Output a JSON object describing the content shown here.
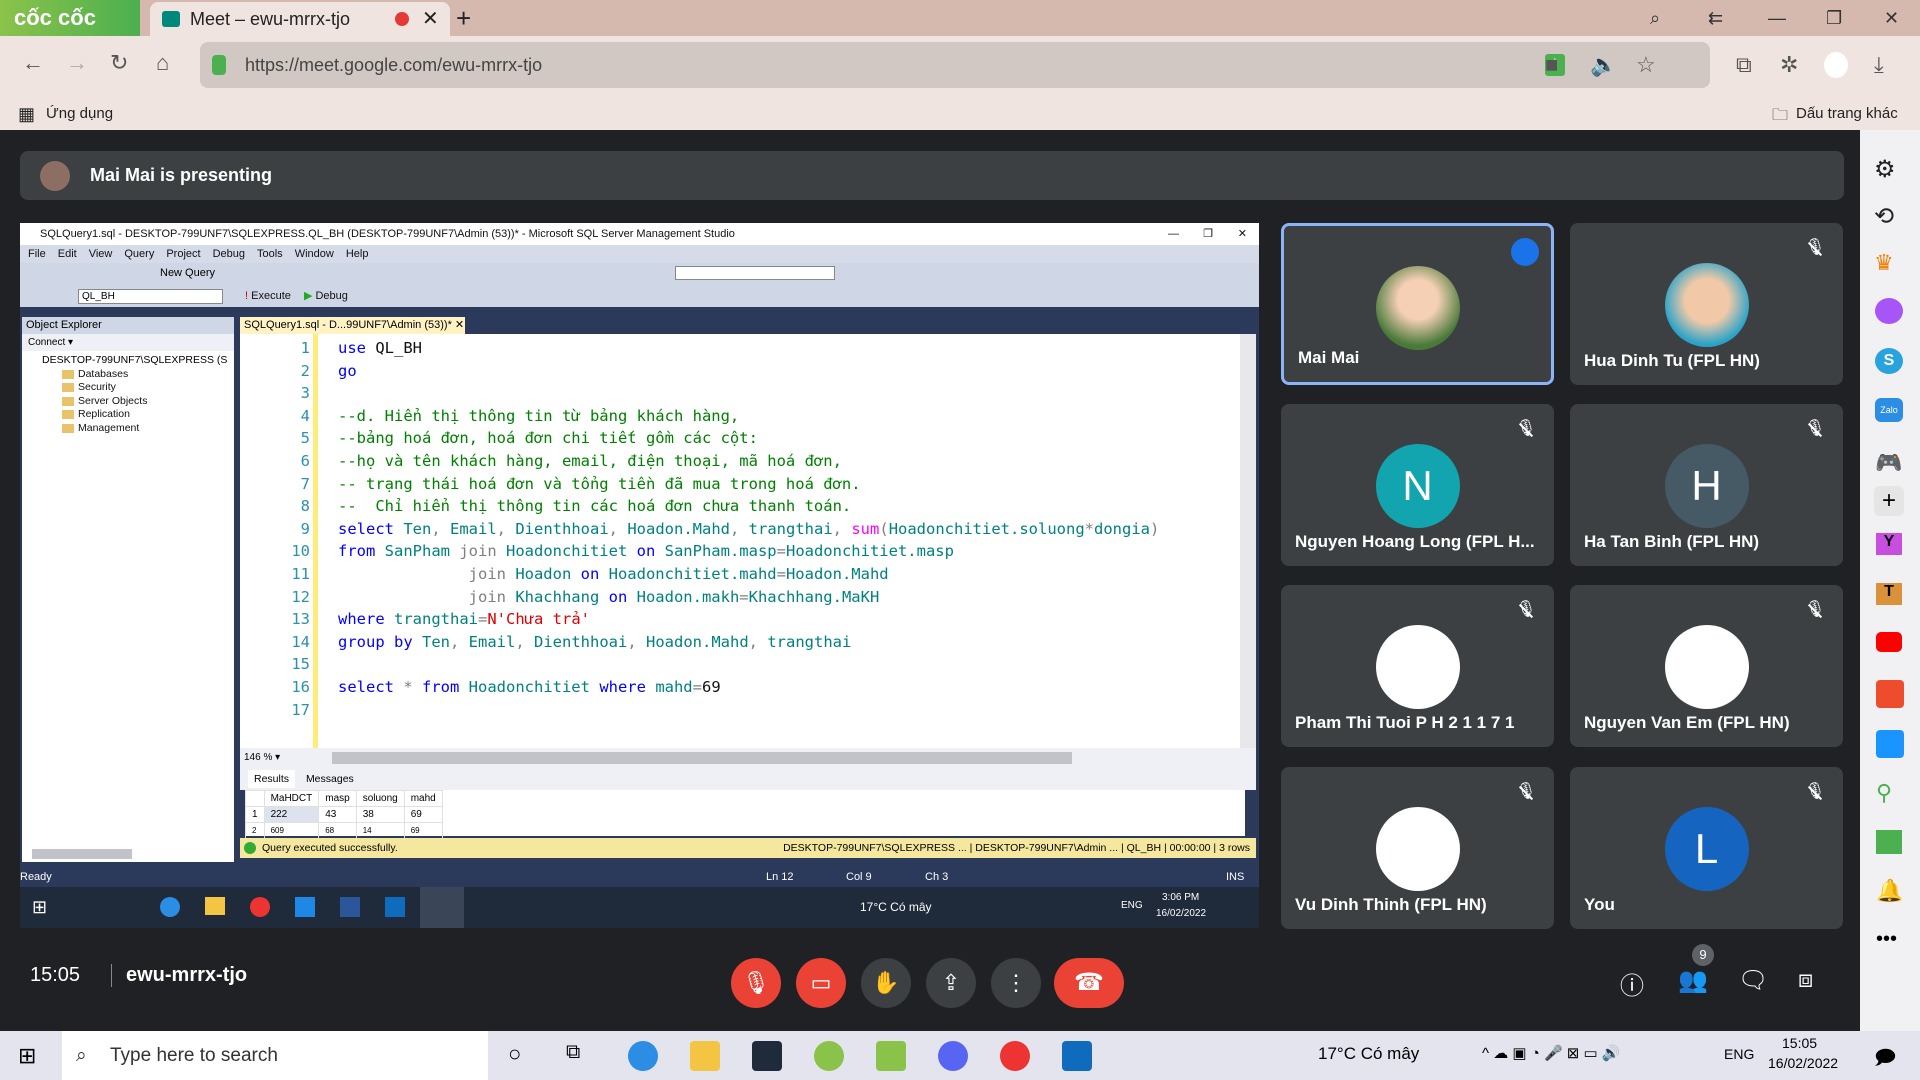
{
  "browser": {
    "brand": "cốc cốc",
    "tab_title": "Meet – ewu-mrrx-tjo",
    "url": "https://meet.google.com/ewu-mrrx-tjo",
    "bookmarks_apps": "Ứng dụng",
    "bookmarks_other": "Dấu trang khác"
  },
  "meet": {
    "presenting": "Mai Mai is presenting",
    "time": "15:05",
    "meeting_code": "ewu-mrrx-tjo",
    "participants_count": "9",
    "tiles": [
      {
        "name": "Mai Mai",
        "type": "photo",
        "speaking": true
      },
      {
        "name": "Hua Dinh Tu (FPL HN)",
        "type": "photo",
        "muted": true
      },
      {
        "name": "Nguyen Hoang Long (FPL H...",
        "initial": "N",
        "color": "#12a4af",
        "muted": true
      },
      {
        "name": "Ha Tan Binh (FPL HN)",
        "initial": "H",
        "color": "#455a64",
        "muted": true
      },
      {
        "name": "Pham Thi Tuoi P H 2 1 1 7 1",
        "type": "sticker",
        "muted": true
      },
      {
        "name": "Nguyen Van Em (FPL HN)",
        "type": "sticker",
        "muted": true
      },
      {
        "name": "Vu Dinh Thinh (FPL HN)",
        "type": "sticker",
        "muted": true
      },
      {
        "name": "You",
        "initial": "L",
        "color": "#1565c0",
        "muted": true
      }
    ]
  },
  "ssms": {
    "title": "SQLQuery1.sql - DESKTOP-799UNF7\\SQLEXPRESS.QL_BH (DESKTOP-799UNF7\\Admin (53))* - Microsoft SQL Server Management Studio",
    "menu": [
      "File",
      "Edit",
      "View",
      "Query",
      "Project",
      "Debug",
      "Tools",
      "Window",
      "Help"
    ],
    "new_query": "New Query",
    "database": "QL_BH",
    "execute": "Execute",
    "debug": "Debug",
    "object_explorer": "Object Explorer",
    "connect": "Connect ▾",
    "server": "DESKTOP-799UNF7\\SQLEXPRESS (S",
    "tree": [
      "Databases",
      "Security",
      "Server Objects",
      "Replication",
      "Management"
    ],
    "editor_tab": "SQLQuery1.sql - D...99UNF7\\Admin (53))*",
    "zoom": "146 %",
    "results_tab": "Results",
    "messages_tab": "Messages",
    "grid_headers": [
      "",
      "MaHDCT",
      "masp",
      "soluong",
      "mahd"
    ],
    "grid_rows": [
      [
        "1",
        "222",
        "43",
        "38",
        "69"
      ],
      [
        "2",
        "609",
        "68",
        "14",
        "69"
      ]
    ],
    "status_msg": "Query executed successfully.",
    "status_server": "DESKTOP-799UNF7\\SQLEXPRESS ...",
    "status_user": "DESKTOP-799UNF7\\Admin ...",
    "status_db": "QL_BH",
    "status_time": "00:00:00",
    "status_rows": "3 rows",
    "ready": "Ready",
    "ln": "Ln 12",
    "col": "Col 9",
    "ch": "Ch 3",
    "ins": "INS",
    "remote_weather": "17°C  Có mây",
    "remote_lang": "ENG",
    "remote_time": "3:06 PM",
    "remote_date": "16/02/2022"
  },
  "code": [
    [
      [
        "kw",
        "use"
      ],
      [
        "",
        " QL_BH"
      ]
    ],
    [
      [
        "kw",
        "go"
      ]
    ],
    [],
    [
      [
        "cm",
        "--d. Hiển thị thông tin từ bảng khách hàng,"
      ]
    ],
    [
      [
        "cm",
        "--bảng hoá đơn, hoá đơn chi tiết gồm các cột:"
      ]
    ],
    [
      [
        "cm",
        "--họ và tên khách hàng, email, điện thoại, mã hoá đơn,"
      ]
    ],
    [
      [
        "cm",
        "-- trạng thái hoá đơn và tổng tiền đã mua trong hoá đơn."
      ]
    ],
    [
      [
        "cm",
        "--  Chỉ hiển thị thông tin các hoá đơn chưa thanh toán."
      ]
    ],
    [
      [
        "kw",
        "select"
      ],
      [
        "id",
        " Ten"
      ],
      [
        "gr",
        ","
      ],
      [
        "id",
        " Email"
      ],
      [
        "gr",
        ","
      ],
      [
        "id",
        " Dienthhoai"
      ],
      [
        "gr",
        ","
      ],
      [
        "id",
        " Hoadon.Mahd"
      ],
      [
        "gr",
        ","
      ],
      [
        "id",
        " trangthai"
      ],
      [
        "gr",
        ", "
      ],
      [
        "fn",
        "sum"
      ],
      [
        "gr",
        "("
      ],
      [
        "id",
        "Hoadonchitiet.soluong"
      ],
      [
        "gr",
        "*"
      ],
      [
        "id",
        "dongia"
      ],
      [
        "gr",
        ")"
      ]
    ],
    [
      [
        "kw",
        "from"
      ],
      [
        "id",
        " SanPham "
      ],
      [
        "gr",
        "join"
      ],
      [
        "id",
        " Hoadonchitiet "
      ],
      [
        "kw",
        "on"
      ],
      [
        "id",
        " SanPham.masp"
      ],
      [
        "gr",
        "="
      ],
      [
        "id",
        "Hoadonchitiet.masp"
      ]
    ],
    [
      [
        "",
        "              "
      ],
      [
        "gr",
        "join"
      ],
      [
        "id",
        " Hoadon "
      ],
      [
        "kw",
        "on"
      ],
      [
        "id",
        " Hoadonchitiet.mahd"
      ],
      [
        "gr",
        "="
      ],
      [
        "id",
        "Hoadon.Mahd"
      ]
    ],
    [
      [
        "",
        "              "
      ],
      [
        "gr",
        "join"
      ],
      [
        "id",
        " Khachhang "
      ],
      [
        "kw",
        "on"
      ],
      [
        "id",
        " Hoadon.makh"
      ],
      [
        "gr",
        "="
      ],
      [
        "id",
        "Khachhang.MaKH"
      ]
    ],
    [
      [
        "kw",
        "where"
      ],
      [
        "id",
        " trangthai"
      ],
      [
        "gr",
        "="
      ],
      [
        "st",
        "N'Chưa trả'"
      ]
    ],
    [
      [
        "kw",
        "group by"
      ],
      [
        "id",
        " Ten"
      ],
      [
        "gr",
        ","
      ],
      [
        "id",
        " Email"
      ],
      [
        "gr",
        ","
      ],
      [
        "id",
        " Dienthhoai"
      ],
      [
        "gr",
        ","
      ],
      [
        "id",
        " Hoadon.Mahd"
      ],
      [
        "gr",
        ","
      ],
      [
        "id",
        " trangthai"
      ]
    ],
    [],
    [
      [
        "kw",
        "select"
      ],
      [
        "gr",
        " * "
      ],
      [
        "kw",
        "from"
      ],
      [
        "id",
        " Hoadonchitiet "
      ],
      [
        "kw",
        "where"
      ],
      [
        "id",
        " mahd"
      ],
      [
        "gr",
        "="
      ],
      [
        "",
        "69"
      ]
    ],
    []
  ],
  "taskbar": {
    "search_placeholder": "Type here to search",
    "weather": "17°C  Có mây",
    "lang": "ENG",
    "time": "15:05",
    "date": "16/02/2022"
  }
}
